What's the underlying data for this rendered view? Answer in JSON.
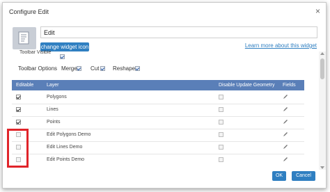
{
  "dialog": {
    "title": "Configure Edit",
    "close_symbol": "×"
  },
  "widget": {
    "name_value": "Edit",
    "change_icon_label": "change widget icon",
    "learn_more_label": "Learn more about this widget"
  },
  "toolbar": {
    "visible_label": "Toolbar Visible",
    "options_label": "Toolbar Options",
    "merge_label": "Merge",
    "cut_label": "Cut",
    "reshape_label": "Reshape"
  },
  "table": {
    "headers": {
      "editable": "Editable",
      "layer": "Layer",
      "disable_geometry": "Disable Update Geometry",
      "fields": "Fields"
    },
    "rows": [
      {
        "layer": "Polygons",
        "editable": true
      },
      {
        "layer": "Lines",
        "editable": true
      },
      {
        "layer": "Points",
        "editable": true
      },
      {
        "layer": "Edit Polygons Demo",
        "editable": false
      },
      {
        "layer": "Edit Lines Demo",
        "editable": false
      },
      {
        "layer": "Edit Points Demo",
        "editable": false
      }
    ]
  },
  "buttons": {
    "ok_label": "OK",
    "cancel_label": "Cancel"
  },
  "colors": {
    "accent": "#2f7fc1",
    "header": "#5a7fb8",
    "highlight": "#e0242a"
  }
}
